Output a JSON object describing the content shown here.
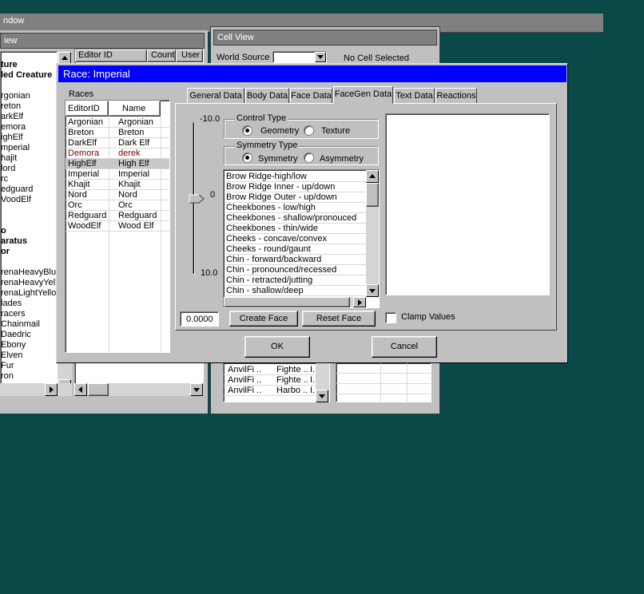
{
  "main_window": {
    "title_partial": "ndow"
  },
  "object_window": {
    "title_partial": "iew",
    "tree_items": [
      {
        "text": "ture",
        "bold": true
      },
      {
        "text": "led Creature",
        "bold": true
      },
      {
        "text": "",
        "bold": false
      },
      {
        "text": "rgonian",
        "bold": false
      },
      {
        "text": "reton",
        "bold": false
      },
      {
        "text": "arkElf",
        "bold": false
      },
      {
        "text": "emora",
        "bold": false
      },
      {
        "text": "ighElf",
        "bold": false
      },
      {
        "text": "mperial",
        "bold": false
      },
      {
        "text": "hajit",
        "bold": false
      },
      {
        "text": "lord",
        "bold": false
      },
      {
        "text": "rc",
        "bold": false
      },
      {
        "text": "edguard",
        "bold": false
      },
      {
        "text": "VoodElf",
        "bold": false
      },
      {
        "text": "",
        "bold": false
      },
      {
        "text": "",
        "bold": false
      },
      {
        "text": "o",
        "bold": true
      },
      {
        "text": "aratus",
        "bold": true
      },
      {
        "text": "or",
        "bold": true
      },
      {
        "text": "",
        "bold": false
      },
      {
        "text": "renaHeavyBlu",
        "bold": false
      },
      {
        "text": "renaHeavyYell",
        "bold": false
      },
      {
        "text": "renaLightYello",
        "bold": false
      },
      {
        "text": "lades",
        "bold": false
      },
      {
        "text": "racers",
        "bold": false
      },
      {
        "text": "Chainmail",
        "bold": false
      },
      {
        "text": "Daedric",
        "bold": false
      },
      {
        "text": "Ebony",
        "bold": false
      },
      {
        "text": "Elven",
        "bold": false
      },
      {
        "text": "Fur",
        "bold": false
      },
      {
        "text": "ron",
        "bold": false
      }
    ],
    "columns": [
      "Editor ID",
      "Count",
      "User"
    ]
  },
  "cell_view": {
    "title": "Cell View",
    "world_source_label": "World Source",
    "no_cell": "No Cell Selected",
    "rows": [
      [
        "AnvilFi ..",
        "Fighte ..",
        "I.."
      ],
      [
        "AnvilFi ..",
        "Fighte ..",
        "I.."
      ],
      [
        "AnvilFi ..",
        "Harbo ..",
        "I.."
      ]
    ]
  },
  "race_dialog": {
    "title": "Race: Imperial",
    "races_label": "Races",
    "col_editor_id": "EditorID",
    "col_name": "Name",
    "races": [
      {
        "id": "Argonian",
        "name": "Argonian",
        "state": "normal"
      },
      {
        "id": "Breton",
        "name": "Breton",
        "state": "normal"
      },
      {
        "id": "DarkElf",
        "name": "Dark Elf",
        "state": "normal"
      },
      {
        "id": "Demora",
        "name": "derek",
        "state": "modified"
      },
      {
        "id": "HighElf",
        "name": "High Elf",
        "state": "selected"
      },
      {
        "id": "Imperial",
        "name": "Imperial",
        "state": "normal"
      },
      {
        "id": "Khajit",
        "name": "Khajit",
        "state": "normal"
      },
      {
        "id": "Nord",
        "name": "Nord",
        "state": "normal"
      },
      {
        "id": "Orc",
        "name": "Orc",
        "state": "normal"
      },
      {
        "id": "Redguard",
        "name": "Redguard",
        "state": "normal"
      },
      {
        "id": "WoodElf",
        "name": "Wood Elf",
        "state": "normal"
      }
    ],
    "tabs": [
      "General Data",
      "Body Data",
      "Face Data",
      "FaceGen Data",
      "Text Data",
      "Reactions"
    ],
    "active_tab": "FaceGen Data",
    "slider": {
      "max_label": "-10.0",
      "mid_label": "0",
      "min_label": "10.0",
      "value_fraction": 0.5
    },
    "control_type": {
      "label": "Control Type",
      "opt_geometry": "Geometry",
      "opt_texture": "Texture",
      "selected": "Geometry"
    },
    "symmetry_type": {
      "label": "Symmetry Type",
      "opt_symmetry": "Symmetry",
      "opt_asymmetry": "Asymmetry",
      "selected": "Symmetry"
    },
    "morphs": [
      "Brow Ridge-high/low",
      "Brow Ridge Inner - up/down",
      "Brow Ridge Outer - up/down",
      "Cheekbones - low/high",
      "Cheekbones - shallow/pronouced",
      "Cheekbones - thin/wide",
      "Cheeks - concave/convex",
      "Cheeks - round/gaunt",
      "Chin - forward/backward",
      "Chin - pronounced/recessed",
      "Chin - retracted/jutting",
      "Chin - shallow/deep"
    ],
    "value_field": "0.0000",
    "create_face": "Create Face",
    "reset_face": "Reset Face",
    "clamp_values": "Clamp Values",
    "ok": "OK",
    "cancel": "Cancel"
  },
  "colors": {
    "title_bar": "#0000ff",
    "desktop": "#0b4848",
    "modified_text": "#800000",
    "selection": "#c8c8c8"
  }
}
